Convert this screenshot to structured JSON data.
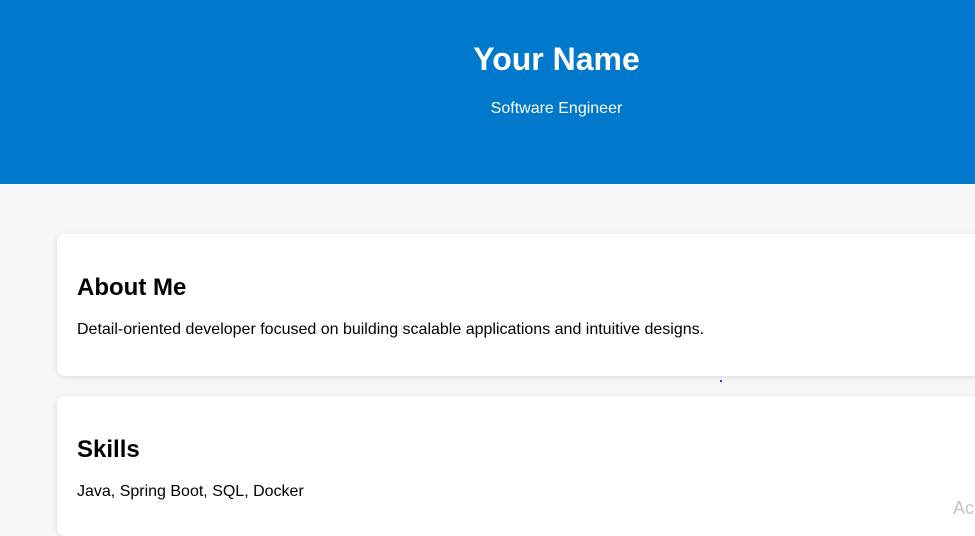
{
  "header": {
    "name": "Your Name",
    "role": "Software Engineer",
    "background_color": "#0078cc"
  },
  "sections": [
    {
      "title": "About Me",
      "text": "Detail-oriented developer focused on building scalable applications and intuitive designs."
    },
    {
      "title": "Skills",
      "text": "Java, Spring Boot, SQL, Docker"
    }
  ],
  "watermark": {
    "text": "Ac"
  }
}
